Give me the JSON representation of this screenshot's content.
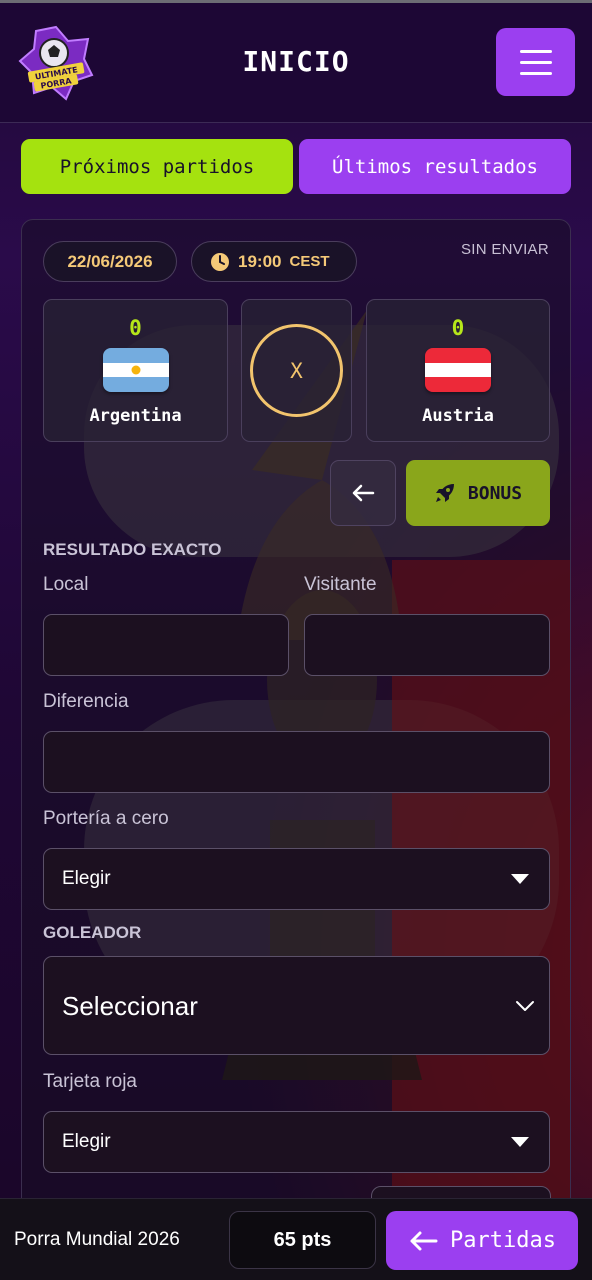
{
  "header": {
    "title": "INICIO",
    "logo_text_line1": "ULTIMATE",
    "logo_text_line2": "PORRA"
  },
  "tabs": [
    {
      "label": "Próximos partidos",
      "active": true
    },
    {
      "label": "Últimos resultados",
      "active": false
    }
  ],
  "match": {
    "date": "22/06/2026",
    "time": "19:00",
    "timezone": "CEST",
    "status": "SIN ENVIAR",
    "home": {
      "name": "Argentina",
      "score": "0"
    },
    "away": {
      "name": "Austria",
      "score": "0"
    },
    "vs_label": "X"
  },
  "actions": {
    "bonus_label": "BONUS"
  },
  "form": {
    "exact_result_title": "RESULTADO EXACTO",
    "local_label": "Local",
    "visitor_label": "Visitante",
    "difference_label": "Diferencia",
    "clean_sheet_label": "Portería a cero",
    "clean_sheet_value": "Elegir",
    "scorer_title": "GOLEADOR",
    "scorer_value": "Seleccionar",
    "red_card_label": "Tarjeta roja",
    "red_card_value": "Elegir"
  },
  "footer": {
    "label": "Porra Mundial 2026",
    "points": "65 pts",
    "partidas_label": "Partidas"
  },
  "colors": {
    "accent_purple": "#9b3ff0",
    "accent_green": "#a5e20f",
    "gold": "#f2c46d"
  }
}
